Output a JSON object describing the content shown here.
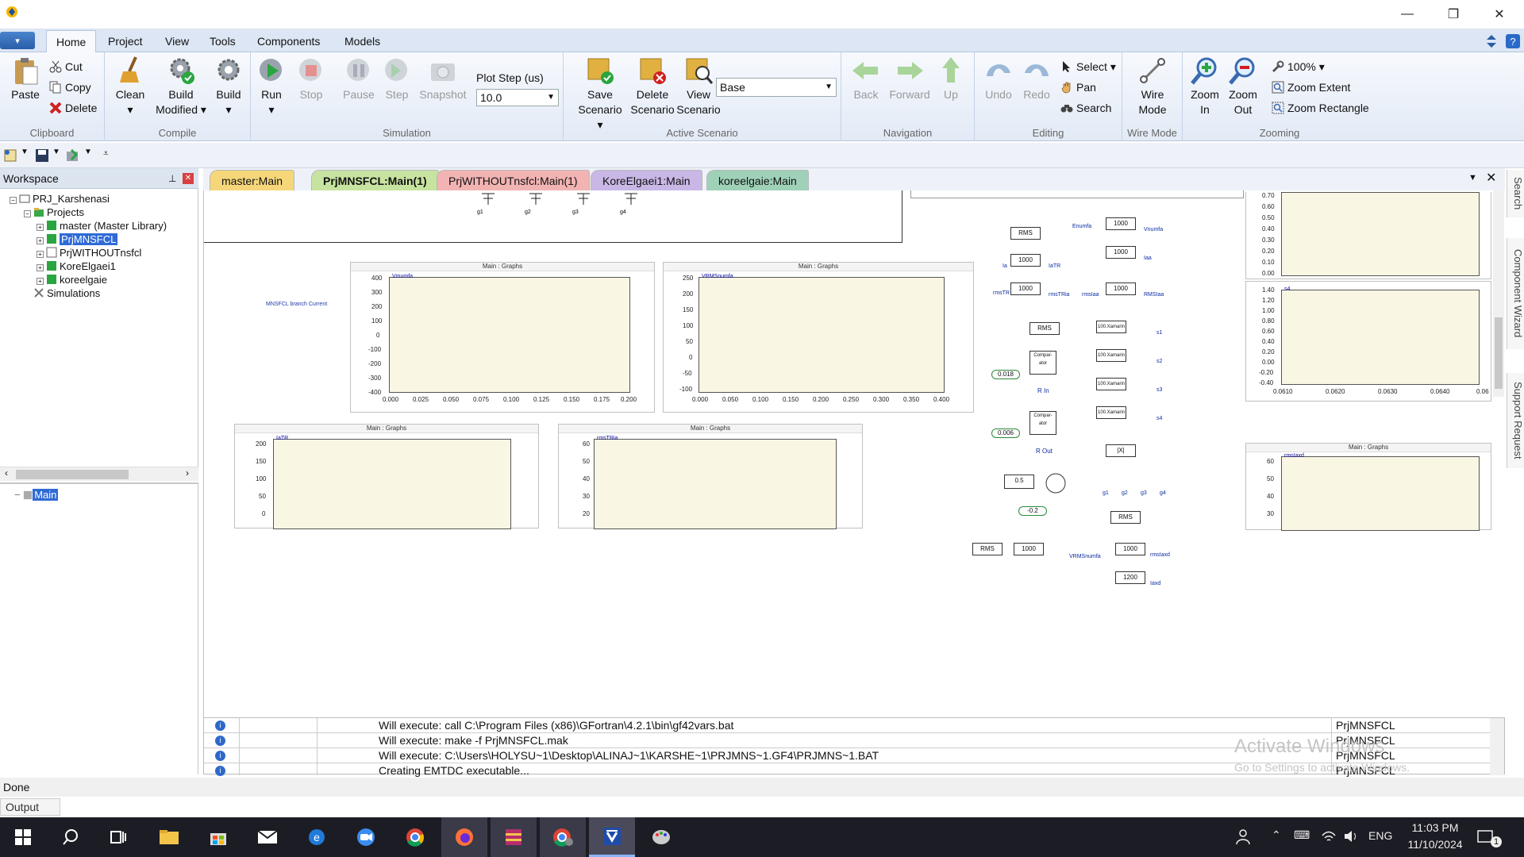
{
  "window": {
    "minimize": "—",
    "restore": "❐",
    "close": "✕"
  },
  "app_button": "▾",
  "menu": {
    "tabs": [
      "Home",
      "Project",
      "View",
      "Tools",
      "Components",
      "Models"
    ]
  },
  "ribbon": {
    "clipboard": {
      "paste": "Paste",
      "cut": "Cut",
      "copy": "Copy",
      "delete": "Delete",
      "label": "Clipboard"
    },
    "compile": {
      "clean": "Clean",
      "build_modified_1": "Build",
      "build_modified_2": "Modified",
      "build": "Build",
      "label": "Compile"
    },
    "simulation": {
      "run": "Run",
      "stop": "Stop",
      "pause": "Pause",
      "step": "Step",
      "snapshot": "Snapshot",
      "plot_step_label": "Plot Step (us)",
      "plot_step_value": "10.0",
      "label": "Simulation"
    },
    "active_scenario": {
      "save_1": "Save",
      "save_2": "Scenario",
      "delete_1": "Delete",
      "delete_2": "Scenario",
      "view_1": "View",
      "view_2": "Scenario",
      "scenario_value": "Base",
      "label": "Active Scenario"
    },
    "navigation": {
      "back": "Back",
      "forward": "Forward",
      "up": "Up",
      "label": "Navigation"
    },
    "editing": {
      "undo": "Undo",
      "redo": "Redo",
      "select": "Select",
      "pan": "Pan",
      "search": "Search",
      "label": "Editing"
    },
    "wire_mode": {
      "wire_1": "Wire",
      "wire_2": "Mode",
      "label": "Wire Mode"
    },
    "zooming": {
      "zoom_in_1": "Zoom",
      "zoom_in_2": "In",
      "zoom_out_1": "Zoom",
      "zoom_out_2": "Out",
      "zoom_level": "100%",
      "zoom_extent": "Zoom Extent",
      "zoom_rectangle": "Zoom Rectangle",
      "label": "Zooming"
    }
  },
  "workspace": {
    "title": "Workspace",
    "root": "PRJ_Karshenasi",
    "projects_label": "Projects",
    "projects": [
      "master (Master Library)",
      "PrjMNSFCL",
      "PrjWITHOUTnsfcl",
      "KoreElgaei1",
      "koreelgaie"
    ],
    "simulations": "Simulations",
    "hierarchy_main": "Main"
  },
  "doc_tabs": [
    {
      "label": "master:Main",
      "color": "#f5d77a"
    },
    {
      "label": "PrjMNSFCL:Main(1)",
      "color": "#c7e3a0"
    },
    {
      "label": "PrjWITHOUTnsfcl:Main(1)",
      "color": "#f2b3b3"
    },
    {
      "label": "KoreElgaei1:Main",
      "color": "#c9b7e6"
    },
    {
      "label": "koreelgaie:Main",
      "color": "#9fd1b8"
    }
  ],
  "canvas": {
    "annotation": "MNSFCL branch Current",
    "graph_title": "Main : Graphs",
    "graphs": [
      {
        "name": "Vmumfa",
        "y_ticks": [
          "400",
          "300",
          "200",
          "100",
          "0",
          "-100",
          "-200",
          "-300",
          "-400"
        ],
        "x_ticks": [
          "0.000",
          "0.025",
          "0.050",
          "0.075",
          "0.100",
          "0.125",
          "0.150",
          "0.175",
          "0.200"
        ]
      },
      {
        "name": "VRMSnumfa",
        "y_ticks": [
          "250",
          "200",
          "150",
          "100",
          "50",
          "0",
          "-50",
          "-100"
        ],
        "x_ticks": [
          "0.000",
          "0.050",
          "0.100",
          "0.150",
          "0.200",
          "0.250",
          "0.300",
          "0.350",
          "0.400"
        ]
      },
      {
        "name": "IaTR",
        "y_ticks": [
          "200",
          "150",
          "100",
          "50",
          "0"
        ]
      },
      {
        "name": "rmsTRia",
        "y_ticks": [
          "60",
          "50",
          "40",
          "30",
          "20"
        ]
      },
      {
        "name": "",
        "y_ticks": [
          "0.70",
          "0.60",
          "0.50",
          "0.40",
          "0.30",
          "0.20",
          "0.10",
          "0.00"
        ]
      },
      {
        "name": "s4",
        "y_ticks": [
          "1.40",
          "1.20",
          "1.00",
          "0.80",
          "0.60",
          "0.40",
          "0.20",
          "0.00",
          "-0.20",
          "-0.40"
        ],
        "x_ticks": [
          "0.0610",
          "0.0620",
          "0.0630",
          "0.0640",
          "0.06"
        ]
      },
      {
        "name": "rmsIaxd",
        "y_ticks": [
          "60",
          "50",
          "40",
          "30"
        ]
      }
    ],
    "blocks": {
      "rms": "RMS",
      "k1000": "1000",
      "k1200": "1200",
      "k05": "0.5",
      "abs": "|X|",
      "cmp": "Compar-ator",
      "x100": "100.Xamarin",
      "const_018": "0.018",
      "const_006": "0.006",
      "const_m02": "-0.2",
      "rin": "R In",
      "rout": "R Out"
    },
    "labels": [
      "Vnumfa",
      "IaTR",
      "rmsTRia",
      "Enumfa",
      "Iaa",
      "RMSIaa",
      "rmsIaa",
      "s1",
      "s2",
      "s3",
      "s4",
      "g1",
      "g2",
      "g3",
      "g4",
      "VRMSnumfa",
      "rmsIaxd",
      "Iaxd",
      "Ia",
      "rmsTR"
    ]
  },
  "output": {
    "rows": [
      {
        "msg": "Will execute: call C:\\Program Files (x86)\\GFortran\\4.2.1\\bin\\gf42vars.bat",
        "src": "PrjMNSFCL"
      },
      {
        "msg": "Will execute: make -f PrjMNSFCL.mak",
        "src": "PrjMNSFCL"
      },
      {
        "msg": "Will execute: C:\\Users\\HOLYSU~1\\Desktop\\ALINAJ~1\\KARSHE~1\\PRJMNS~1.GF4\\PRJMNS~1.BAT",
        "src": "PrjMNSFCL"
      },
      {
        "msg": "Creating EMTDC executable...",
        "src": "PrjMNSFCL"
      }
    ],
    "watermark_1": "Activate Windows",
    "watermark_2": "Go to Settings to activate Windows."
  },
  "status": "Done",
  "output_tab": "Output",
  "side_tabs": [
    "Search",
    "Component Wizard",
    "Support Request"
  ],
  "taskbar": {
    "time": "11:03 PM",
    "date": "11/10/2024",
    "lang": "ENG",
    "notif": "1"
  }
}
